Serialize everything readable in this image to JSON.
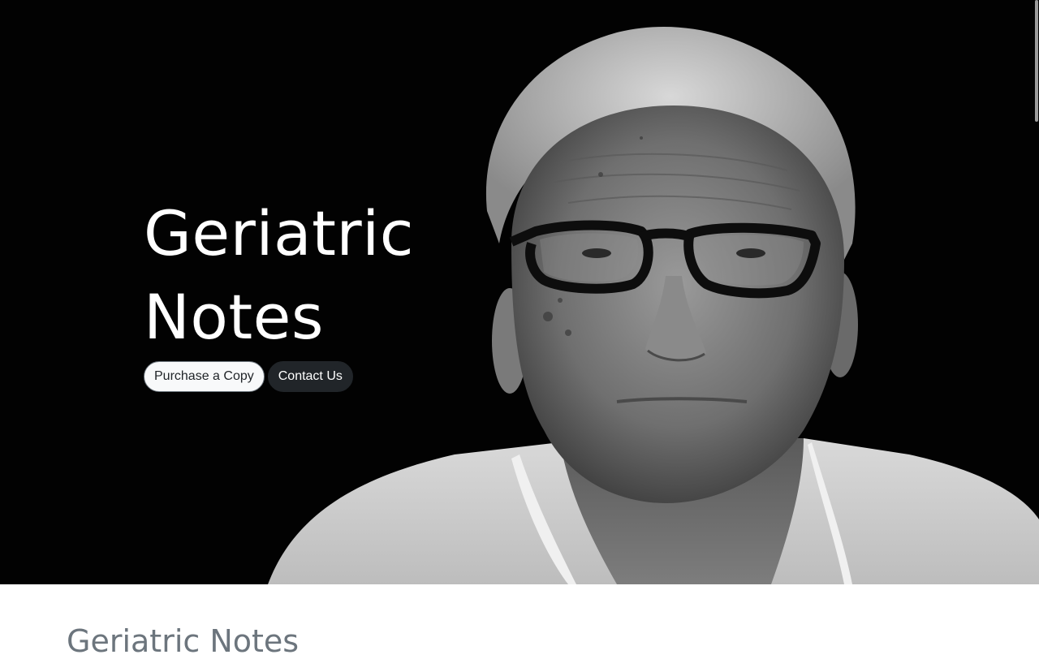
{
  "hero": {
    "title_line1": "Geriatric",
    "title_line2": "Notes",
    "background_color": "#020202",
    "image_subject": "portrait-of-elderly-man-with-glasses",
    "buttons": {
      "purchase_label": "Purchase a Copy",
      "contact_label": "Contact Us"
    }
  },
  "section": {
    "title": "Geriatric Notes"
  },
  "colors": {
    "light_button": "#f8f9fa",
    "dark_button": "#212529",
    "section_title": "#6c757d"
  }
}
